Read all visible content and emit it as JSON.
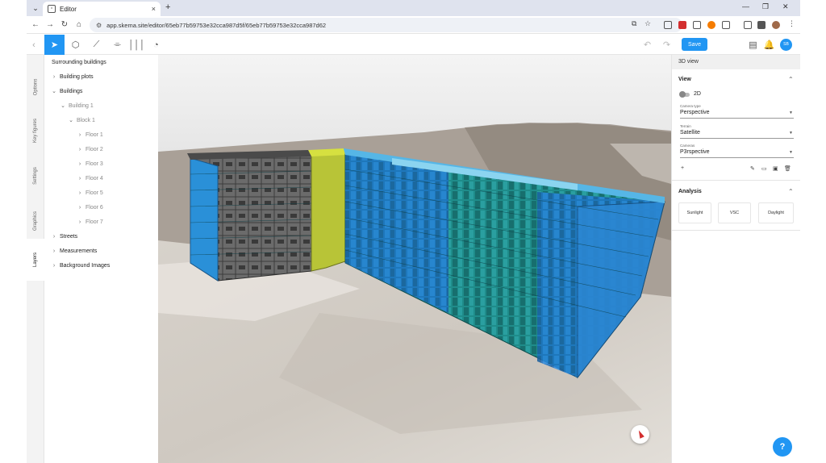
{
  "browser": {
    "tab_title": "Editor",
    "url": "app.skema.site/editor/65eb77b59753e32cca987d5f/65eb77b59753e32cca987d62"
  },
  "toolbar": {
    "save_label": "Save",
    "avatar_initials": "SB",
    "colors": {
      "accent": "#2196f3"
    }
  },
  "vtabs": [
    "Options",
    "Key figures",
    "Settings",
    "Graphics",
    "Layers"
  ],
  "tree": {
    "surrounding": "Surrounding buildings",
    "plots": "Building plots",
    "buildings": "Buildings",
    "building1": "Building 1",
    "block1": "Block 1",
    "floors": [
      "Floor 1",
      "Floor 2",
      "Floor 3",
      "Floor 4",
      "Floor 5",
      "Floor 6",
      "Floor 7"
    ],
    "streets": "Streets",
    "measurements": "Measurements",
    "background": "Background Images"
  },
  "right_panel": {
    "header": "3D view",
    "view_title": "View",
    "toggle_label": "2D",
    "camera_type_label": "Camera type",
    "camera_type_value": "Perspective",
    "terrain_label": "Terrain",
    "terrain_value": "Satellite",
    "cameras_label": "Cameras",
    "cameras_value": "P3rspective",
    "analysis_title": "Analysis",
    "analysis_buttons": [
      "Sunlight",
      "VSC",
      "Daylight"
    ]
  },
  "help_label": "?"
}
